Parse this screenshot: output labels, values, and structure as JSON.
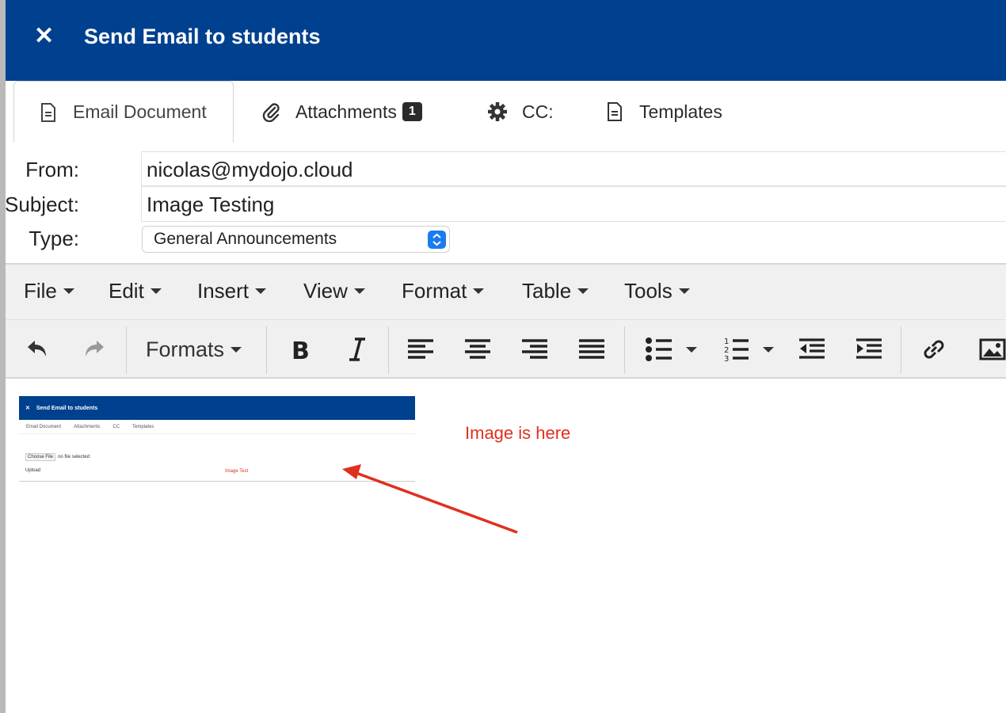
{
  "header": {
    "close_glyph": "✕",
    "title": "Send Email to students",
    "bg_color": "#00418f"
  },
  "tabs": [
    {
      "icon": "document-icon",
      "label": "Email Document",
      "active": true
    },
    {
      "icon": "paperclip-icon",
      "label": "Attachments",
      "badge": "1"
    },
    {
      "icon": "gear-icon",
      "label": "CC:"
    },
    {
      "icon": "document-icon",
      "label": "Templates"
    }
  ],
  "form": {
    "from_label": "From:",
    "from_value": "nicolas@mydojo.cloud",
    "subject_label": "Subject:",
    "subject_value": "Image Testing",
    "type_label": "Type:",
    "type_value": "General Announcements"
  },
  "menubar": [
    "File",
    "Edit",
    "Insert",
    "View",
    "Format",
    "Table",
    "Tools"
  ],
  "toolbar": {
    "formats_label": "Formats",
    "icons": [
      "undo-icon",
      "redo-icon",
      "bold-icon",
      "italic-icon",
      "align-left-icon",
      "align-center-icon",
      "align-right-icon",
      "align-justify-icon",
      "bullet-list-icon",
      "numbered-list-icon",
      "outdent-icon",
      "indent-icon",
      "link-icon",
      "image-icon"
    ]
  },
  "editor": {
    "annotation": "Image is here",
    "annotation_color": "#e03020",
    "embedded_image": {
      "title": "Send Email to students",
      "tabs": [
        "Email Document",
        "Attachments",
        "CC",
        "Templates"
      ],
      "choose_file": "Choose File",
      "no_file": "no file selected",
      "upload": "Upload",
      "image_text": "Image Test"
    }
  }
}
